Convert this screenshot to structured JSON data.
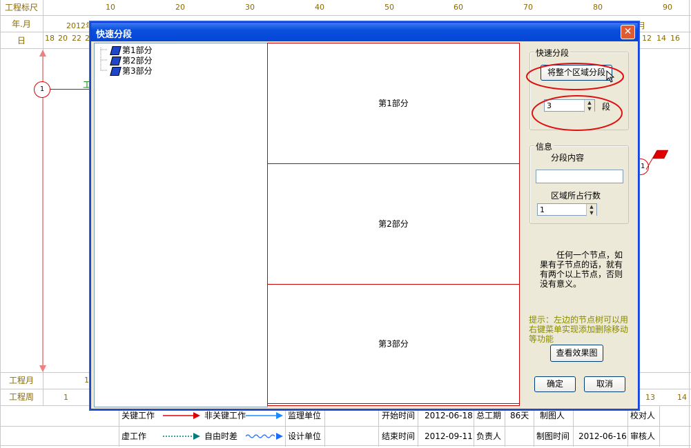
{
  "background": {
    "row_labels": {
      "scale": "工程标尺",
      "year_month": "年.月",
      "day": "日",
      "project_month": "工程月",
      "project_week": "工程周"
    },
    "scale_ticks": [
      "10",
      "20",
      "30",
      "40",
      "50",
      "60",
      "70",
      "80",
      "90"
    ],
    "year_text": "2012年",
    "month_right": "月",
    "days_left": [
      "18",
      "20",
      "22",
      "2"
    ],
    "days_right": [
      "12",
      "14",
      "16"
    ],
    "project_month_value": "1",
    "week_left": "1",
    "week_right": [
      "13",
      "14"
    ],
    "node_left": "1",
    "node_right": "11",
    "green_text": "工"
  },
  "dialog": {
    "title": "快速分段",
    "close_symbol": "✕",
    "tree_items": [
      "第1部分",
      "第2部分",
      "第3部分"
    ],
    "parts": [
      "第1部分",
      "第2部分",
      "第3部分"
    ],
    "quick_group": {
      "title": "快速分段",
      "split_button": "将整个区域分段",
      "segments_value": "3",
      "segments_unit": "段"
    },
    "info_group": {
      "title": "信息",
      "content_label": "分段内容",
      "content_value": "",
      "rows_label": "区域所占行数",
      "rows_value": "1"
    },
    "note": "任何一个节点，如果有子节点的话，就有有两个以上节点，否则没有意义。",
    "hint": "提示：左边的节点树可以用右键菜单实现添加删除移动等功能",
    "preview_button": "查看效果图",
    "ok_button": "确定",
    "cancel_button": "取消"
  },
  "legend": {
    "critical": "关键工作",
    "non_critical": "非关键工作",
    "dummy": "虚工作",
    "free_float": "自由时差",
    "supervisor_unit": "监理单位",
    "design_unit": "设计单位",
    "start_label": "开始时间",
    "start_value": "2012-06-18",
    "end_label": "结束时间",
    "end_value": "2012-09-11",
    "duration_label": "总工期",
    "duration_value": "86天",
    "owner_label": "负责人",
    "drawer_label": "制图人",
    "draw_time_label": "制图时间",
    "draw_time_value": "2012-06-16",
    "checker_label": "校对人",
    "reviewer_label": "审核人"
  },
  "colors": {
    "critical": "#e00000",
    "non_critical": "#1a8cff",
    "free_float": "#1a6cff",
    "dummy": "#007a7a",
    "olive": "#8a6a00"
  }
}
